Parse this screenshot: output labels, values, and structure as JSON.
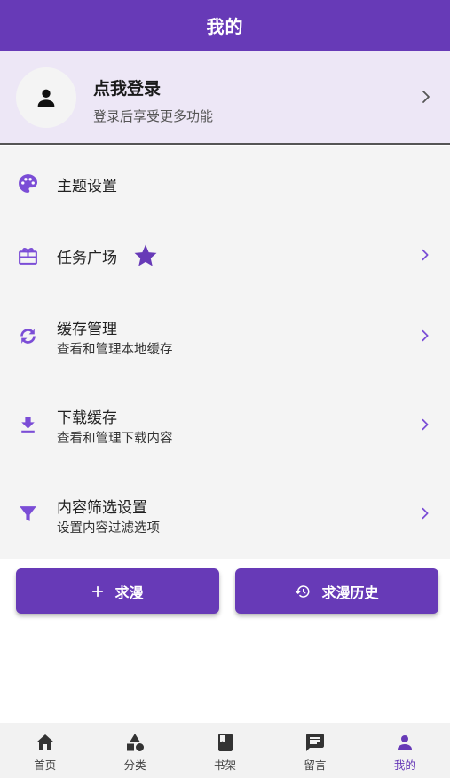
{
  "app_bar": {
    "title": "我的"
  },
  "login": {
    "title": "点我登录",
    "subtitle": "登录后享受更多功能"
  },
  "menu": [
    {
      "label": "主题设置",
      "icon": "palette-icon"
    },
    {
      "label": "任务广场",
      "icon": "gift-icon",
      "badge_icon": "star-icon"
    },
    {
      "label": "缓存管理",
      "subtitle": "查看和管理本地缓存",
      "icon": "sync-icon"
    },
    {
      "label": "下载缓存",
      "subtitle": "查看和管理下载内容",
      "icon": "download-icon"
    },
    {
      "label": "内容筛选设置",
      "subtitle": "设置内容过滤选项",
      "icon": "filter-icon"
    }
  ],
  "actions": {
    "request": {
      "label": "求漫",
      "icon": "plus-icon"
    },
    "history": {
      "label": "求漫历史",
      "icon": "history-icon"
    }
  },
  "bottom_nav": [
    {
      "label": "首页",
      "icon": "home-icon"
    },
    {
      "label": "分类",
      "icon": "category-icon"
    },
    {
      "label": "书架",
      "icon": "book-icon"
    },
    {
      "label": "留言",
      "icon": "message-icon"
    },
    {
      "label": "我的",
      "icon": "person-icon",
      "active": true
    }
  ],
  "colors": {
    "primary": "#673ab7",
    "primary_light": "#ede7f6",
    "icon_purple": "#7b4dd6",
    "background": "#f4f4f4"
  }
}
